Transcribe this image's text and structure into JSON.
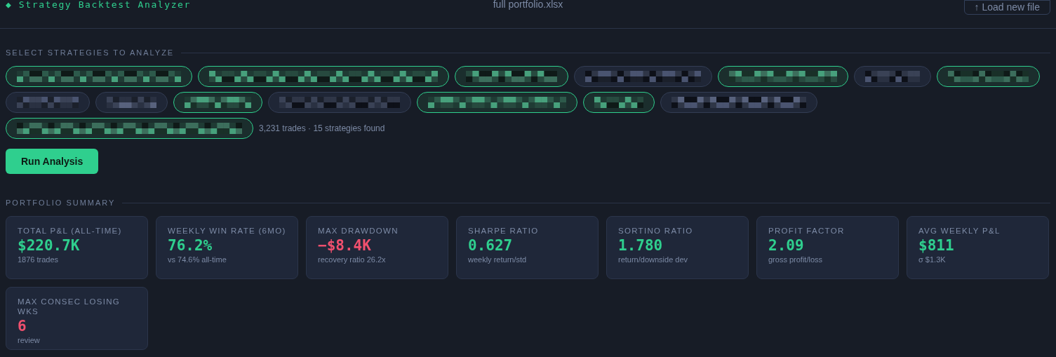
{
  "header": {
    "title": "◆ Strategy Backtest Analyzer",
    "file_name": "full portfolio.xlsx",
    "load_button": "↑ Load new file"
  },
  "strategy_section": {
    "heading": "SELECT STRATEGIES TO ANALYZE",
    "strategies": [
      {
        "kind": "picture",
        "selected": true
      },
      {
        "kind": "picture",
        "selected": true
      },
      {
        "kind": "picture",
        "selected": true
      },
      {
        "kind": "picture",
        "selected": false
      },
      {
        "kind": "picture",
        "selected": true
      },
      {
        "kind": "picture",
        "selected": false
      },
      {
        "kind": "picture",
        "selected": true
      },
      {
        "kind": "picture",
        "selected": false
      },
      {
        "kind": "picture",
        "selected": false
      },
      {
        "kind": "picture",
        "selected": true
      },
      {
        "kind": "picture",
        "selected": false
      },
      {
        "kind": "picture",
        "selected": true
      },
      {
        "kind": "picture",
        "selected": true
      },
      {
        "kind": "picture",
        "selected": false
      },
      {
        "kind": "picture",
        "selected": true
      }
    ],
    "summary": "3,231 trades · 15 strategies found",
    "run_button": "Run Analysis"
  },
  "portfolio_summary": {
    "heading": "PORTFOLIO SUMMARY",
    "metrics": [
      {
        "label": "TOTAL P&L (ALL-TIME)",
        "value": "$220.7K",
        "negative": false,
        "note": "1876 trades"
      },
      {
        "label": "WEEKLY WIN RATE (6MO)",
        "value": "76.2%",
        "negative": false,
        "note": "vs 74.6% all-time"
      },
      {
        "label": "MAX DRAWDOWN",
        "value": "−$8.4K",
        "negative": true,
        "note": "recovery ratio 26.2x"
      },
      {
        "label": "SHARPE RATIO",
        "value": "0.627",
        "negative": false,
        "note": "weekly return/std"
      },
      {
        "label": "SORTINO RATIO",
        "value": "1.780",
        "negative": false,
        "note": "return/downside dev"
      },
      {
        "label": "PROFIT FACTOR",
        "value": "2.09",
        "negative": false,
        "note": "gross profit/loss"
      },
      {
        "label": "AVG WEEKLY P&L",
        "value": "$811",
        "negative": false,
        "note": "σ $1.3K"
      },
      {
        "label": "MAX CONSEC LOSING WKS",
        "value": "6",
        "negative": true,
        "note": "review"
      }
    ]
  }
}
